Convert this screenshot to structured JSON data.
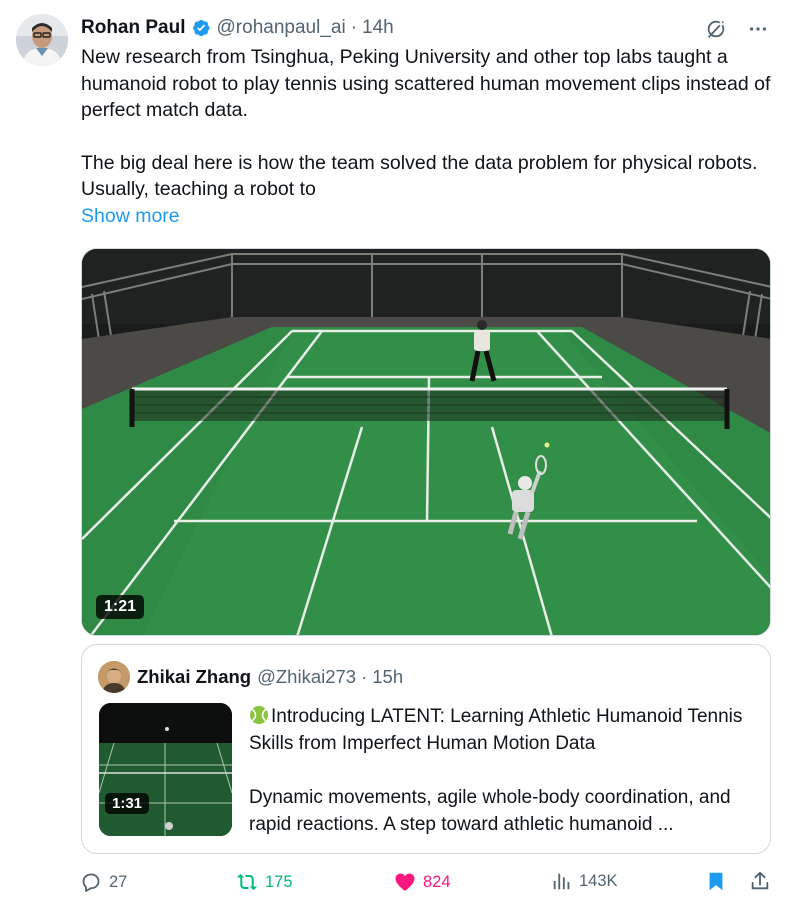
{
  "author": {
    "name": "Rohan Paul",
    "handle": "@rohanpaul_ai",
    "separator": "·",
    "time": "14h",
    "verified": true
  },
  "tweet": {
    "paragraph1": "New research from Tsinghua, Peking University and other top labs taught a humanoid robot to play tennis using scattered human movement clips instead of perfect match data.",
    "paragraph2": "The big deal here is how the team solved the data problem for physical robots. Usually, teaching a robot to",
    "show_more": "Show more"
  },
  "media": {
    "duration": "1:21"
  },
  "quote": {
    "name": "Zhikai Zhang",
    "handle": "@Zhikai273",
    "separator": "·",
    "time": "15h",
    "emoji": "tennis-ball-icon",
    "line1": "Introducing LATENT: Learning Athletic Humanoid Tennis Skills from Imperfect Human Motion Data",
    "line2": "Dynamic movements,  agile whole-body coordination, and rapid reactions. A step toward athletic humanoid ...",
    "thumb_duration": "1:31"
  },
  "actions": {
    "replies": "27",
    "reposts": "175",
    "likes": "824",
    "views": "143K"
  },
  "colors": {
    "accent": "#1d9bf0",
    "repost": "#00ba7c",
    "like": "#f91880",
    "secondary_text": "#536471",
    "court_green": "#2f8a45"
  }
}
